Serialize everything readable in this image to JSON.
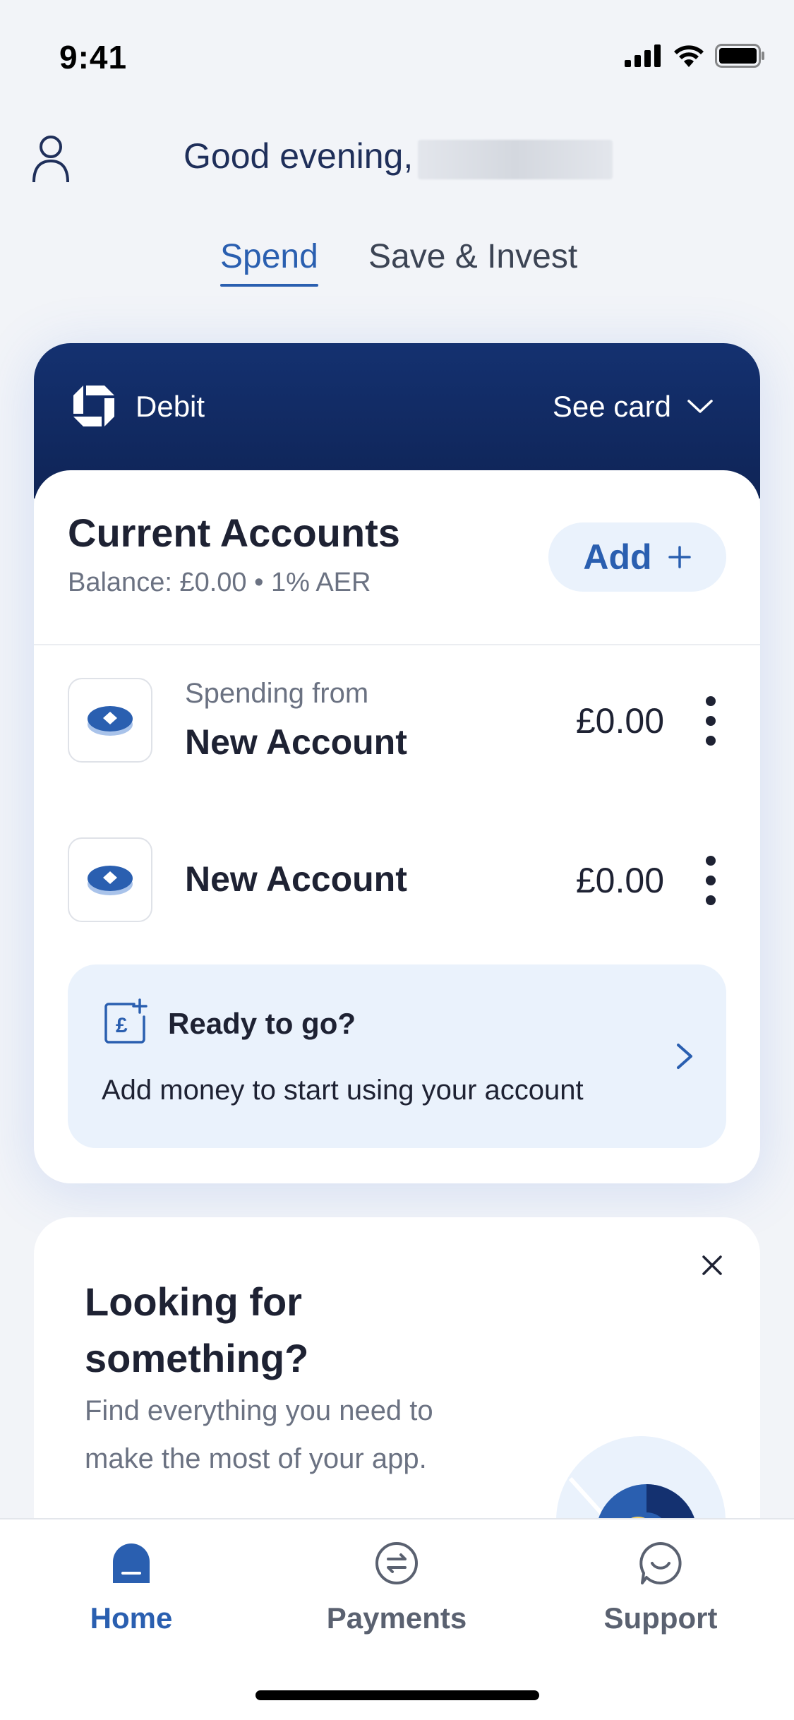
{
  "status_bar": {
    "time": "9:41",
    "icons": [
      "signal-icon",
      "wifi-icon",
      "battery-icon"
    ]
  },
  "header": {
    "greeting": "Good evening,",
    "profile_icon": "person-icon"
  },
  "tabs": [
    {
      "label": "Spend",
      "selected": true
    },
    {
      "label": "Save & Invest",
      "selected": false
    }
  ],
  "card": {
    "type_label": "Debit",
    "see_card_label": "See card",
    "section_title": "Current Accounts",
    "balance_line": "Balance: £0.00 • 1% AER",
    "add_label": "Add",
    "accounts": [
      {
        "subtitle": "Spending from",
        "name": "New Account",
        "amount": "£0.00"
      },
      {
        "subtitle": "",
        "name": "New Account",
        "amount": "£0.00"
      }
    ],
    "ready": {
      "title": "Ready to go?",
      "text": "Add money to start using your account"
    }
  },
  "promo": {
    "title": "Looking for something?",
    "text": "Find everything you need to make the most of your app."
  },
  "tab_bar": [
    {
      "label": "Home",
      "icon": "home-icon",
      "selected": true
    },
    {
      "label": "Payments",
      "icon": "payments-icon",
      "selected": false
    },
    {
      "label": "Support",
      "icon": "chat-icon",
      "selected": false
    }
  ],
  "colors": {
    "brand_blue": "#2a5fb0",
    "card_navy": "#143170",
    "light_blue_bg": "#eaf2fc",
    "page_bg": "#f2f4f8"
  }
}
